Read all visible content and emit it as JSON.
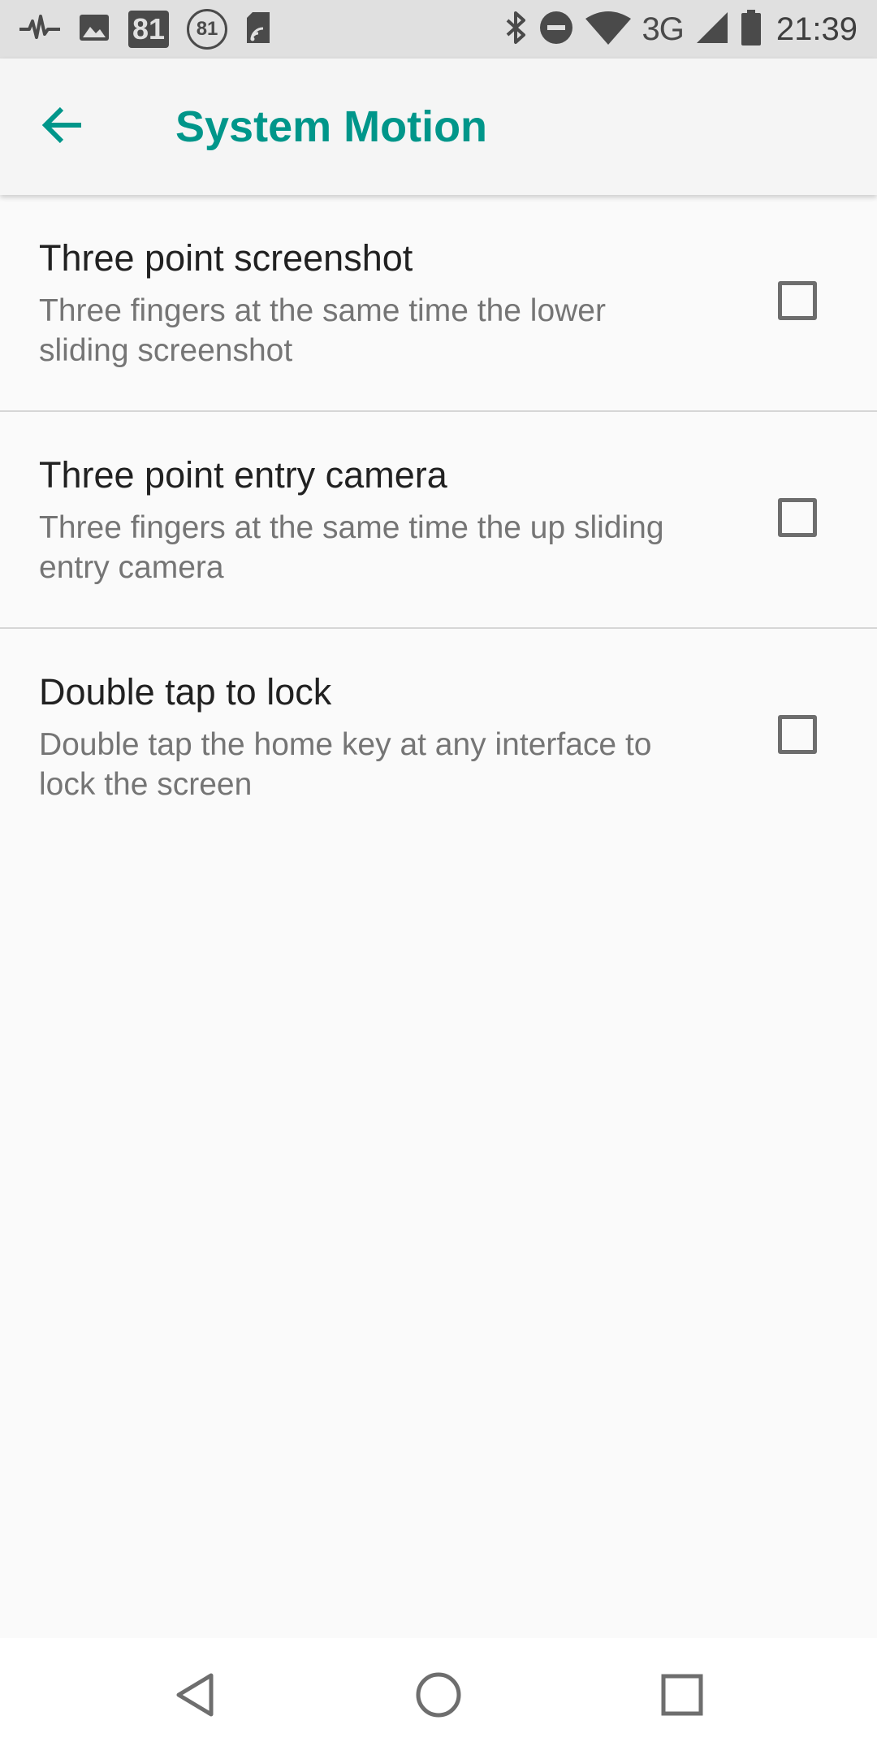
{
  "status_bar": {
    "notification_badge": "81",
    "notification_circle": "81",
    "network_type": "3G",
    "time": "21:39",
    "icons_left": [
      "pulse-icon",
      "image-icon",
      "badge-81-icon",
      "circle-81-icon",
      "sd-card-icon"
    ],
    "icons_right": [
      "bluetooth-icon",
      "do-not-disturb-icon",
      "wifi-icon",
      "cell-signal-icon",
      "battery-icon"
    ]
  },
  "app_bar": {
    "title": "System Motion",
    "back_icon": "arrow-back-icon",
    "accent_color": "#00968a"
  },
  "settings": [
    {
      "title": "Three point screenshot",
      "summary": "Three fingers at the same time the lower sliding screenshot",
      "checked": false
    },
    {
      "title": "Three point entry camera",
      "summary": "Three fingers at the same time the up sliding entry camera",
      "checked": false
    },
    {
      "title": "Double tap to lock",
      "summary": "Double tap the home key at any interface to lock the screen",
      "checked": false
    }
  ],
  "nav_bar": {
    "icons": [
      "nav-back-icon",
      "nav-home-icon",
      "nav-recents-icon"
    ]
  }
}
